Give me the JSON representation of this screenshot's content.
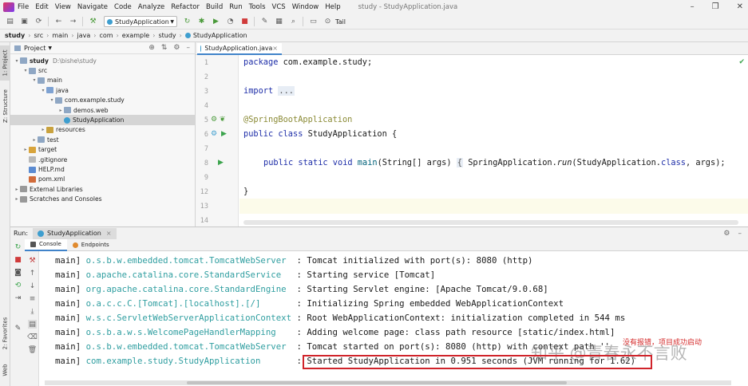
{
  "window": {
    "title": "study - StudyApplication.java",
    "menu": [
      "File",
      "Edit",
      "View",
      "Navigate",
      "Code",
      "Analyze",
      "Refactor",
      "Build",
      "Run",
      "Tools",
      "VCS",
      "Window",
      "Help"
    ]
  },
  "toolbar": {
    "run_config": "StudyApplication",
    "tail_label": "Tail"
  },
  "breadcrumb": [
    "study",
    "src",
    "main",
    "java",
    "com",
    "example",
    "study",
    "StudyApplication"
  ],
  "side_tabs": {
    "project": "1: Project",
    "structure": "Z: Structure",
    "favorites": "2: Favorites",
    "web": "Web"
  },
  "project": {
    "header": "Project",
    "tree": [
      {
        "label": "study",
        "path": "D:\\bishe\\study",
        "icon": "folder-icon",
        "depth": 0,
        "expanded": true
      },
      {
        "label": "src",
        "depth": 1,
        "icon": "folder-icon",
        "expanded": true
      },
      {
        "label": "main",
        "depth": 2,
        "icon": "folder-icon",
        "expanded": true
      },
      {
        "label": "java",
        "depth": 3,
        "icon": "source-folder-icon",
        "expanded": true
      },
      {
        "label": "com.example.study",
        "depth": 4,
        "icon": "package-icon",
        "expanded": true
      },
      {
        "label": "demos.web",
        "depth": 5,
        "icon": "package-icon",
        "expanded": false
      },
      {
        "label": "StudyApplication",
        "depth": 5,
        "icon": "spring-class-icon",
        "selected": true
      },
      {
        "label": "resources",
        "depth": 3,
        "icon": "resources-folder-icon",
        "expanded": false
      },
      {
        "label": "test",
        "depth": 2,
        "icon": "folder-icon",
        "expanded": false
      },
      {
        "label": "target",
        "depth": 1,
        "icon": "excluded-folder-icon",
        "expanded": false
      },
      {
        "label": ".gitignore",
        "depth": 1,
        "icon": "file-icon"
      },
      {
        "label": "HELP.md",
        "depth": 1,
        "icon": "markdown-file-icon"
      },
      {
        "label": "pom.xml",
        "depth": 1,
        "icon": "maven-file-icon"
      },
      {
        "label": "External Libraries",
        "depth": 0,
        "icon": "library-icon",
        "expanded": false
      },
      {
        "label": "Scratches and Consoles",
        "depth": 0,
        "icon": "scratches-icon",
        "expanded": false
      }
    ]
  },
  "editor": {
    "tab": "StudyApplication.java",
    "line_numbers": [
      "1",
      "2",
      "3",
      "4",
      "5",
      "6",
      "7",
      "8",
      "9",
      "12",
      "13",
      "14"
    ],
    "code": {
      "l1_kw": "package",
      "l1_rest": " com.example.study;",
      "l3_kw": "import",
      "l3_fold": "...",
      "l6_ann": "@SpringBootApplication",
      "l7_kw": "public class",
      "l7_rest": " StudyApplication {",
      "l9_kw1": "public static void",
      "l9_method": " main",
      "l9_rest1": "(String[] args) ",
      "l9_fold1": "{",
      "l9_rest2": " SpringApplication.",
      "l9_run": "run",
      "l9_rest3": "(StudyApplication.",
      "l9_class": "class",
      "l9_rest4": ", args); ",
      "l13": "}"
    }
  },
  "run": {
    "label": "Run:",
    "config": "StudyApplication",
    "tabs": [
      "Console",
      "Endpoints"
    ],
    "log": [
      {
        "thread": "main]",
        "logger": "o.s.b.w.embedded.tomcat.TomcatWebServer ",
        "msg": " : Tomcat initialized with port(s): 8080 (http)"
      },
      {
        "thread": "main]",
        "logger": "o.apache.catalina.core.StandardService  ",
        "msg": " : Starting service [Tomcat]"
      },
      {
        "thread": "main]",
        "logger": "org.apache.catalina.core.StandardEngine ",
        "msg": " : Starting Servlet engine: [Apache Tomcat/9.0.68]"
      },
      {
        "thread": "main]",
        "logger": "o.a.c.c.C.[Tomcat].[localhost].[/]      ",
        "msg": " : Initializing Spring embedded WebApplicationContext"
      },
      {
        "thread": "main]",
        "logger": "w.s.c.ServletWebServerApplicationContext",
        "msg": " : Root WebApplicationContext: initialization completed in 544 ms"
      },
      {
        "thread": "main]",
        "logger": "o.s.b.a.w.s.WelcomePageHandlerMapping   ",
        "msg": " : Adding welcome page: class path resource [static/index.html]"
      },
      {
        "thread": "main]",
        "logger": "o.s.b.w.embedded.tomcat.TomcatWebServer ",
        "msg": " : Tomcat started on port(s): 8080 (http) with context path ''"
      },
      {
        "thread": "main]",
        "logger": "com.example.study.StudyApplication      ",
        "msg": " : Started StudyApplication in 0.951 seconds (JVM running for 1.62)"
      }
    ],
    "annotation_note": "没有报错，项目成功启动",
    "watermark": "知乎 @青春永不言败"
  },
  "colors": {
    "accent": "#4083c9",
    "logger": "#2f9ea0",
    "keyword": "#1e2ea8",
    "annotation": "#8a8a35",
    "highlight_box": "#d0242b"
  }
}
